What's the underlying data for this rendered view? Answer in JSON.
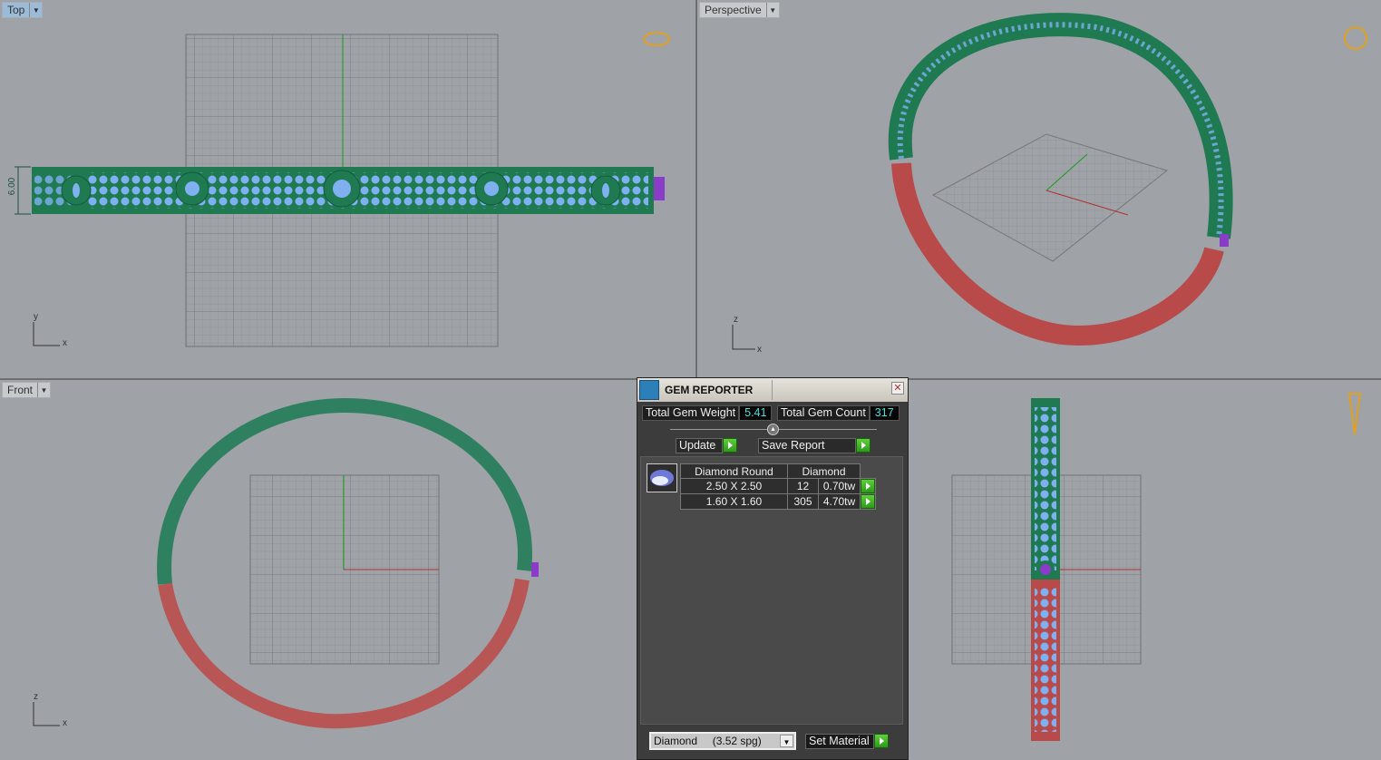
{
  "viewports": {
    "top": {
      "label": "Top",
      "dim": "6.00",
      "axis_v": "y",
      "axis_h": "x"
    },
    "perspective": {
      "label": "Perspective",
      "axis_v": "z",
      "axis_h": "x"
    },
    "front": {
      "label": "Front",
      "axis_v": "z",
      "axis_h": "x"
    }
  },
  "colors": {
    "viewport_bg": "#9fa3a8",
    "ring_green": "#1f7a52",
    "ring_red": "#b84a4a",
    "gems": "#7fb0f0",
    "gem_purple": "#8a3cc8"
  },
  "gem_reporter": {
    "title": "GEM REPORTER",
    "total_weight_label": "Total Gem Weight",
    "total_weight": "5.41",
    "total_count_label": "Total Gem Count",
    "total_count": "317",
    "update_label": "Update",
    "save_report_label": "Save Report",
    "table": {
      "headers": [
        "Diamond Round",
        "Diamond"
      ],
      "rows": [
        {
          "size": "2.50 X 2.50",
          "count": "12",
          "weight": "0.70tw"
        },
        {
          "size": "1.60 X 1.60",
          "count": "305",
          "weight": "4.70tw"
        }
      ]
    },
    "material": "Diamond     (3.52 spg)",
    "set_material_label": "Set Material"
  }
}
